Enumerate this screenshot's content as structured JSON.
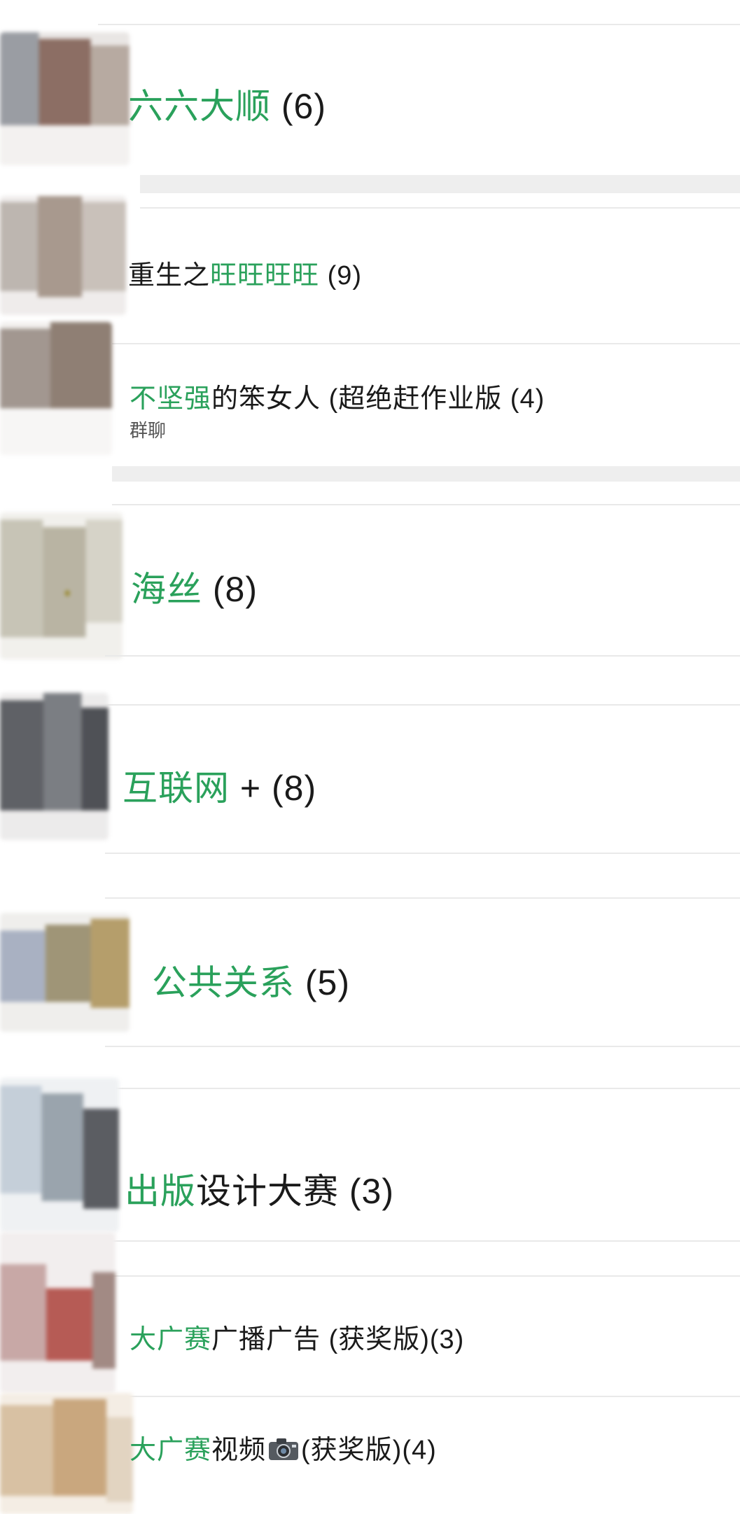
{
  "chats": [
    {
      "title_hl": "六六大顺",
      "title_rest": "",
      "count": "(6)",
      "subtitle": ""
    },
    {
      "title_pre": "重生之",
      "title_hl": "旺旺旺旺",
      "title_rest": "",
      "count": "(9)",
      "subtitle": ""
    },
    {
      "title_hl": "不坚强",
      "title_rest": "的笨女人 (超绝赶作业版",
      "count": "(4)",
      "subtitle": "群聊"
    },
    {
      "title_hl": "海丝",
      "title_rest": "",
      "count": "(8)",
      "subtitle": ""
    },
    {
      "title_hl": "互联网",
      "title_rest": "+",
      "count": "(8)",
      "subtitle": ""
    },
    {
      "title_hl": "公共关系",
      "title_rest": "",
      "count": "(5)",
      "subtitle": ""
    },
    {
      "title_hl": "出版",
      "title_rest": "设计大赛",
      "count": "(3)",
      "subtitle": ""
    },
    {
      "title_hl": "大广赛",
      "title_rest": "广播广告 (获奖版)",
      "count": "(3)",
      "subtitle": ""
    },
    {
      "title_hl": "大广赛",
      "title_rest": "视频",
      "title_after_icon": "(获奖版)",
      "count": "(4)",
      "subtitle": "",
      "icon": "camera-icon"
    }
  ],
  "colors": {
    "highlight": "#2aa15b",
    "text": "#1a1a1a",
    "section_gap": "#eeeeee"
  }
}
